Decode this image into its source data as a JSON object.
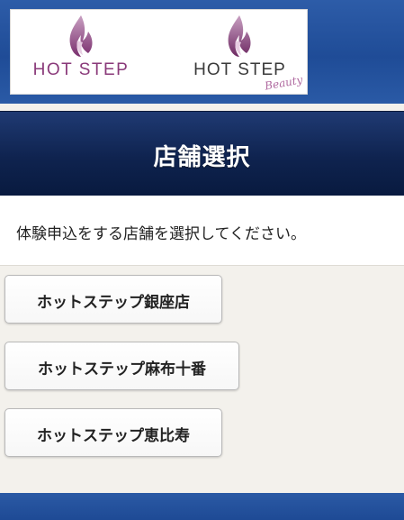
{
  "header": {
    "brands": [
      {
        "name": "HOT STEP",
        "icon": "flame-logo-icon",
        "color": "#8a3a7a"
      },
      {
        "name": "HOT STEP",
        "script": "Beauty",
        "icon": "flame-logo-icon",
        "color": "#3a3a3a"
      }
    ]
  },
  "page": {
    "title": "店舗選択",
    "instruction": "体験申込をする店舗を選択してください。"
  },
  "stores": [
    {
      "label": "ホットステップ銀座店"
    },
    {
      "label": "ホットステップ麻布十番"
    },
    {
      "label": "ホットステップ恵比寿"
    }
  ],
  "colors": {
    "header_blue": "#1f4c97",
    "title_navy": "#0f234f",
    "brand_purple": "#8a3a7a",
    "background": "#f3f1ec"
  }
}
